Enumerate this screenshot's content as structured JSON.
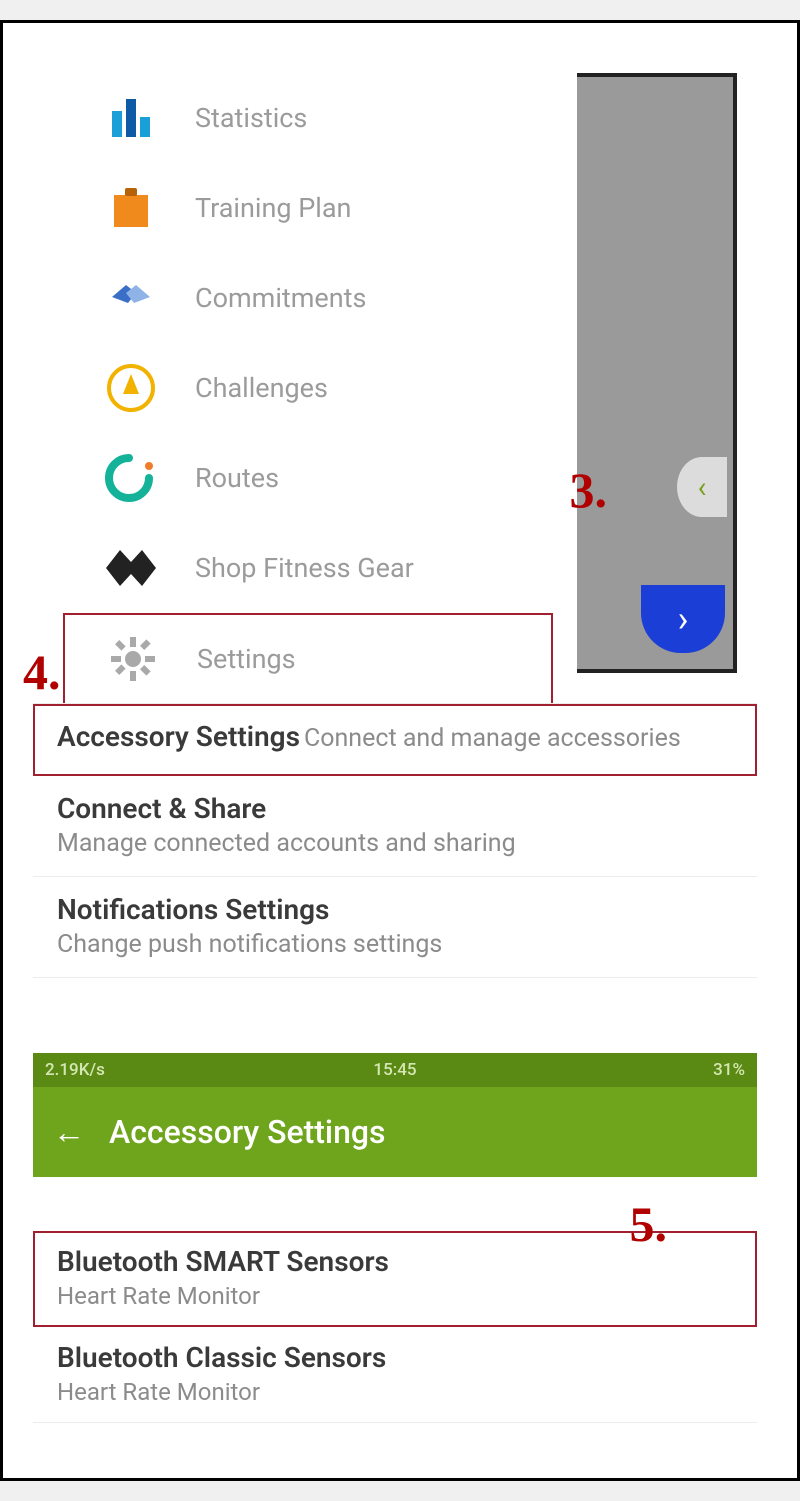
{
  "annotations": {
    "n3": "3.",
    "n4": "4.",
    "n5": "5."
  },
  "drawer": {
    "items": [
      {
        "label": "Statistics",
        "icon": "stats"
      },
      {
        "label": "Training Plan",
        "icon": "plan"
      },
      {
        "label": "Commitments",
        "icon": "commit"
      },
      {
        "label": "Challenges",
        "icon": "chal"
      },
      {
        "label": "Routes",
        "icon": "routes"
      },
      {
        "label": "Shop Fitness Gear",
        "icon": "shop"
      },
      {
        "label": "Settings",
        "icon": "gear",
        "highlighted": true
      }
    ]
  },
  "settings": {
    "rows": [
      {
        "title": "Accessory Settings",
        "sub": "Connect and manage accessories",
        "highlighted": true
      },
      {
        "title": "Connect & Share",
        "sub": "Manage connected accounts and sharing"
      },
      {
        "title": "Notifications Settings",
        "sub": "Change push notifications settings"
      }
    ]
  },
  "accessory_screen": {
    "status_left": "2.19K/s",
    "status_time": "15:45",
    "status_right": "31%",
    "title": "Accessory Settings",
    "rows": [
      {
        "title": "Bluetooth SMART Sensors",
        "sub": "Heart Rate Monitor",
        "highlighted": true
      },
      {
        "title": "Bluetooth Classic Sensors",
        "sub": "Heart Rate Monitor"
      }
    ]
  }
}
